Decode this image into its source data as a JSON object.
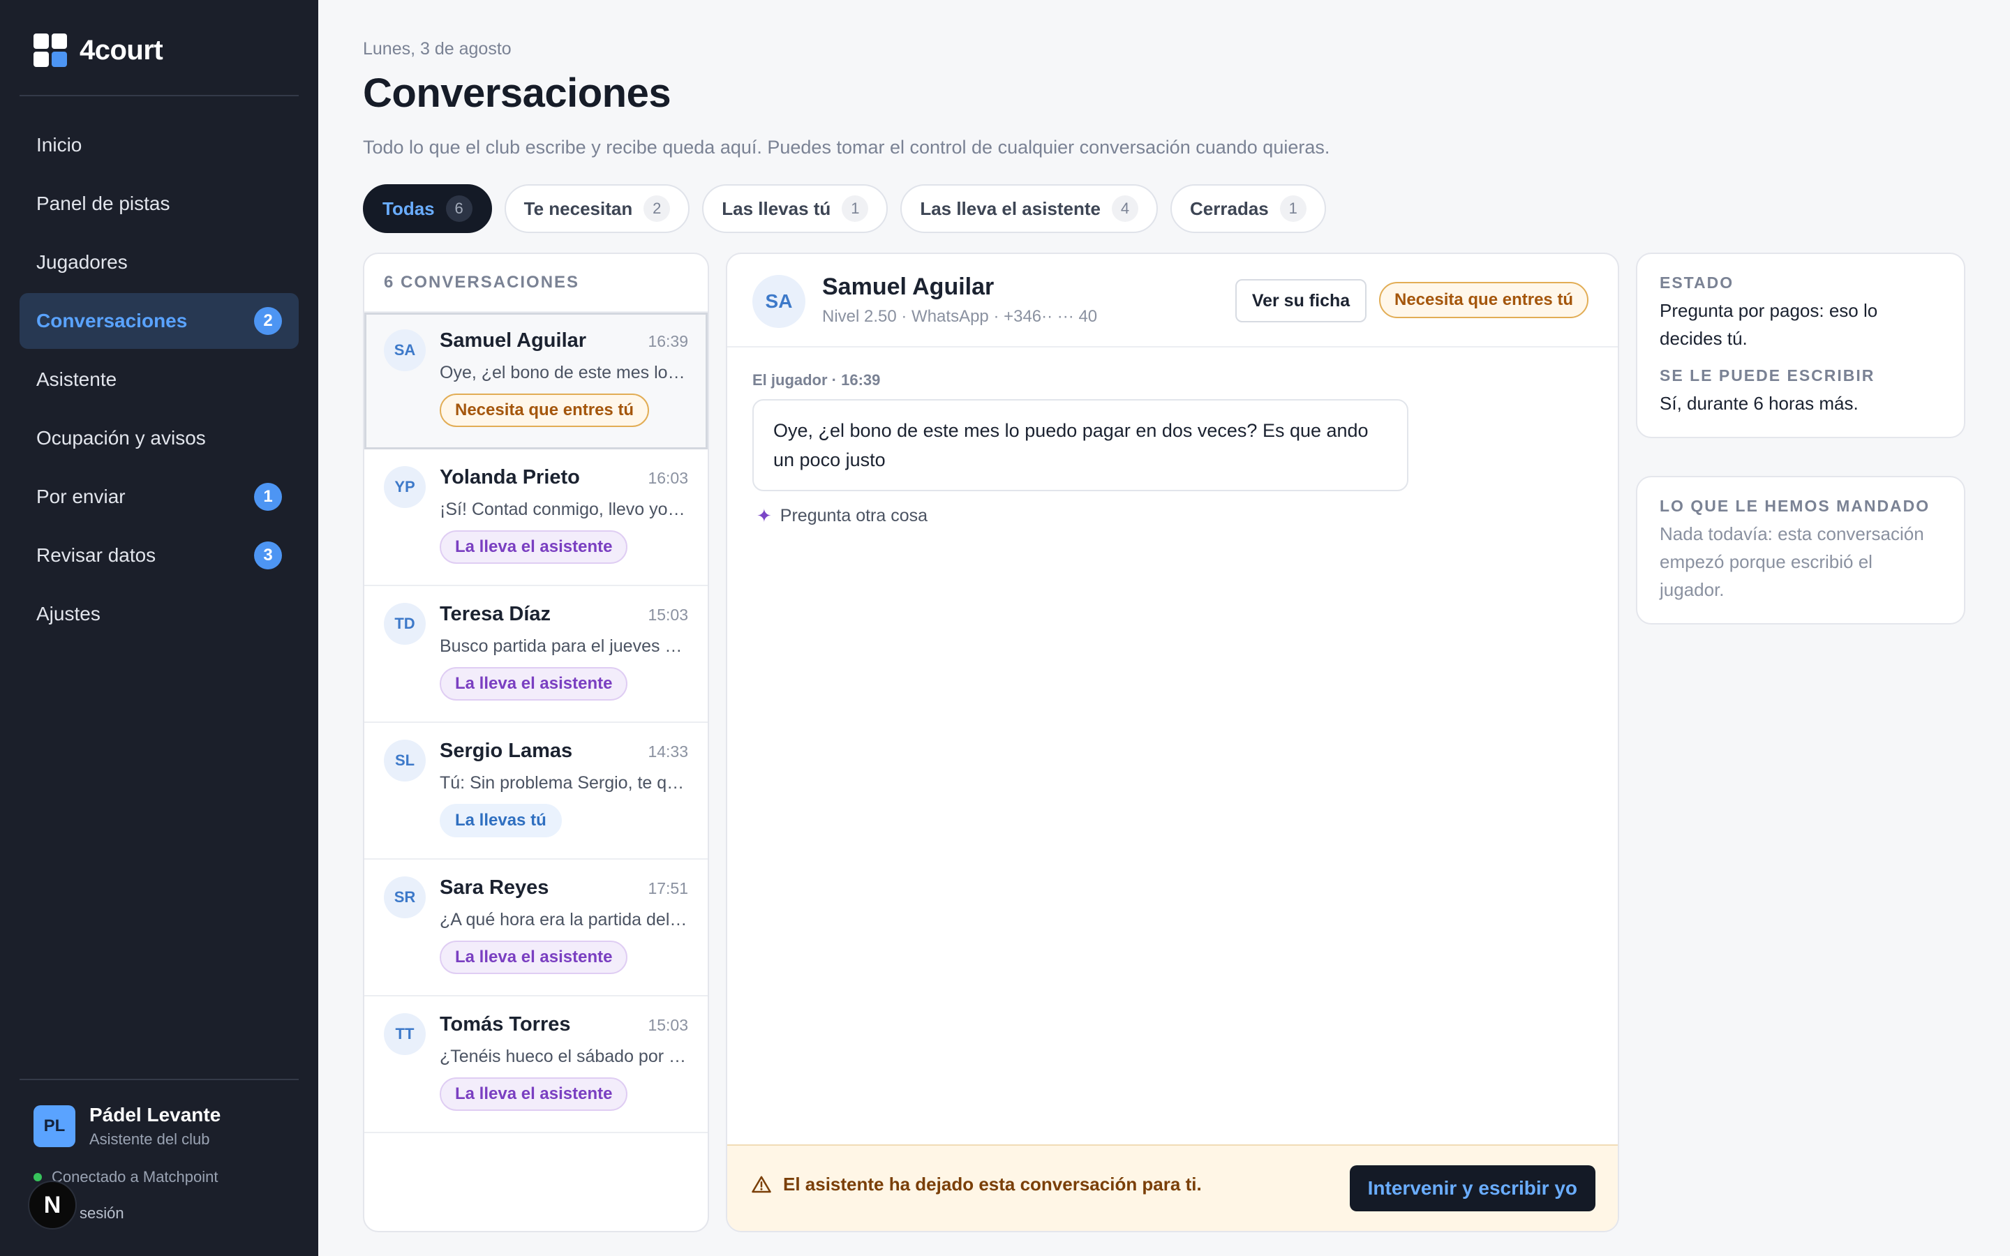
{
  "brand": {
    "name": "4court"
  },
  "nav": {
    "items": [
      {
        "label": "Inicio",
        "badge": ""
      },
      {
        "label": "Panel de pistas",
        "badge": ""
      },
      {
        "label": "Jugadores",
        "badge": ""
      },
      {
        "label": "Conversaciones",
        "badge": "2"
      },
      {
        "label": "Asistente",
        "badge": ""
      },
      {
        "label": "Ocupación y avisos",
        "badge": ""
      },
      {
        "label": "Por enviar",
        "badge": "1"
      },
      {
        "label": "Revisar datos",
        "badge": "3"
      },
      {
        "label": "Ajustes",
        "badge": ""
      }
    ]
  },
  "club": {
    "initials": "PL",
    "name": "Pádel Levante",
    "role": "Asistente del club",
    "status": "Conectado a Matchpoint",
    "logout": "sesión",
    "overlay_letter": "N"
  },
  "header": {
    "date": "Lunes, 3 de agosto",
    "title": "Conversaciones",
    "subtitle": "Todo lo que el club escribe y recibe queda aquí. Puedes tomar el control de cualquier conversación cuando quieras."
  },
  "filters": [
    {
      "label": "Todas",
      "count": "6"
    },
    {
      "label": "Te necesitan",
      "count": "2"
    },
    {
      "label": "Las llevas tú",
      "count": "1"
    },
    {
      "label": "Las lleva el asistente",
      "count": "4"
    },
    {
      "label": "Cerradas",
      "count": "1"
    }
  ],
  "list": {
    "heading": "6 CONVERSACIONES",
    "conversations": [
      {
        "initials": "SA",
        "name": "Samuel Aguilar",
        "time": "16:39",
        "preview": "Oye, ¿el bono de este mes lo puedo pagar en dos veces?",
        "tag": "Necesita que entres tú"
      },
      {
        "initials": "YP",
        "name": "Yolanda Prieto",
        "time": "16:03",
        "preview": "¡Sí! Contad conmigo, llevo yo las bolas",
        "tag": "La lleva el asistente"
      },
      {
        "initials": "TD",
        "name": "Teresa Díaz",
        "time": "15:03",
        "preview": "Busco partida para el jueves por la tarde",
        "tag": "La lleva el asistente"
      },
      {
        "initials": "SL",
        "name": "Sergio Lamas",
        "time": "14:33",
        "preview": "Tú: Sin problema Sergio, te quito la reserva",
        "tag": "La llevas tú"
      },
      {
        "initials": "SR",
        "name": "Sara Reyes",
        "time": "17:51",
        "preview": "¿A qué hora era la partida del viernes?",
        "tag": "La lleva el asistente"
      },
      {
        "initials": "TT",
        "name": "Tomás Torres",
        "time": "15:03",
        "preview": "¿Tenéis hueco el sábado por la mañana?",
        "tag": "La lleva el asistente"
      }
    ]
  },
  "chat": {
    "initials": "SA",
    "name": "Samuel Aguilar",
    "meta": "Nivel 2.50 · WhatsApp · +346·· ··· 40",
    "profile_button": "Ver su ficha",
    "status_tag": "Necesita que entres tú",
    "message_meta": "El jugador · 16:39",
    "message": "Oye, ¿el bono de este mes lo puedo pagar en dos veces? Es que ando un poco justo",
    "ask_other": "Pregunta otra cosa",
    "footer_warning": "El asistente ha dejado esta conversación para ti.",
    "intervene_button": "Intervenir y escribir yo"
  },
  "info": {
    "state_label": "ESTADO",
    "state_text": "Pregunta por pagos: eso lo decides tú.",
    "write_label": "SE LE PUEDE ESCRIBIR",
    "write_text": "Sí, durante 6 horas más.",
    "sent_label": "LO QUE LE HEMOS MANDADO",
    "sent_text": "Nada todavía: esta conversación empezó porque escribió el jugador."
  },
  "colors": {
    "sidebar_bg": "#1b1f2a",
    "accent_blue": "#4d95f3",
    "warning_orange": "#e2ad55",
    "assistant_purple": "#7a3fc1"
  }
}
